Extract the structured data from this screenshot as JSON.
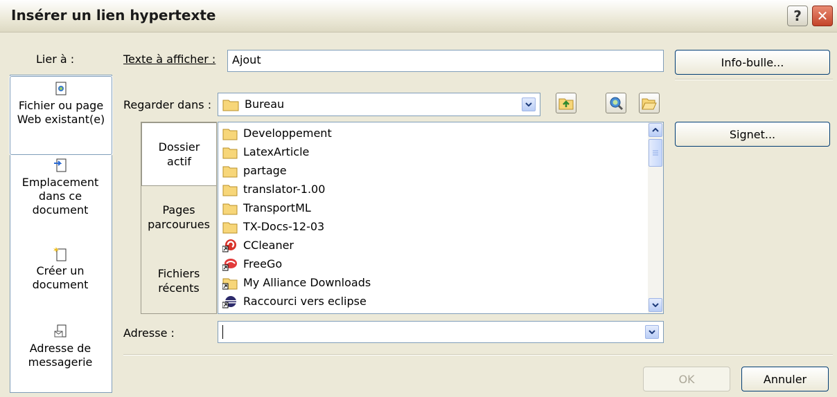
{
  "window": {
    "title": "Insérer un lien hypertexte",
    "help_label": "?",
    "close_label": "✕"
  },
  "link_to": {
    "label": "Lier à :",
    "items": [
      {
        "label": "Fichier ou page Web existant(e)",
        "icon": "web-page-icon",
        "selected": true
      },
      {
        "label": "Emplacement dans ce document",
        "icon": "document-place-icon"
      },
      {
        "label": "Créer un document",
        "icon": "new-document-icon"
      },
      {
        "label": "Adresse de messagerie",
        "icon": "email-icon"
      }
    ]
  },
  "text_to_display": {
    "label": "Texte à afficher :",
    "value": "Ajout"
  },
  "screentip_button": "Info-bulle...",
  "look_in": {
    "label": "Regarder dans :",
    "value": "Bureau"
  },
  "browse_tabs": [
    {
      "label": "Dossier actif",
      "active": true
    },
    {
      "label": "Pages parcourues"
    },
    {
      "label": "Fichiers récents"
    }
  ],
  "files": [
    {
      "name": "Developpement",
      "icon": "folder-icon"
    },
    {
      "name": "LatexArticle",
      "icon": "folder-icon"
    },
    {
      "name": "partage",
      "icon": "folder-icon"
    },
    {
      "name": "translator-1.00",
      "icon": "folder-icon"
    },
    {
      "name": "TransportML",
      "icon": "folder-icon"
    },
    {
      "name": "TX-Docs-12-03",
      "icon": "folder-icon"
    },
    {
      "name": "CCleaner",
      "icon": "ccleaner-shortcut-icon"
    },
    {
      "name": "FreeGo",
      "icon": "freego-shortcut-icon"
    },
    {
      "name": "My Alliance Downloads",
      "icon": "folder-shortcut-icon"
    },
    {
      "name": "Raccourci vers eclipse",
      "icon": "eclipse-shortcut-icon"
    }
  ],
  "bookmark_button": "Signet...",
  "address": {
    "label": "Adresse :",
    "value": ""
  },
  "ok_button": "OK",
  "cancel_button": "Annuler",
  "colors": {
    "field_border": "#7f9db9",
    "dialog_bg": "#ece9d8",
    "close_red": "#c4442a"
  }
}
